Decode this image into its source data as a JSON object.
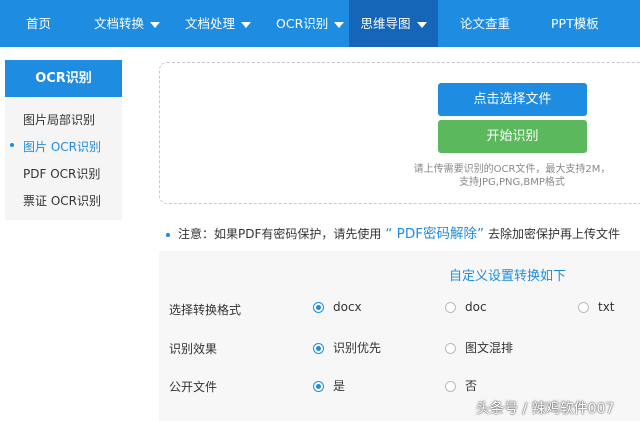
{
  "nav": {
    "items": [
      {
        "label": "首页",
        "has_caret": false
      },
      {
        "label": "文档转换",
        "has_caret": true
      },
      {
        "label": "文档处理",
        "has_caret": true
      },
      {
        "label": "OCR识别",
        "has_caret": true
      },
      {
        "label": "思维导图",
        "has_caret": true,
        "active": true
      },
      {
        "label": "论文查重",
        "has_caret": false
      },
      {
        "label": "PPT模板",
        "has_caret": false
      }
    ]
  },
  "sidebar": {
    "title": "OCR识别",
    "items": [
      {
        "label": "图片局部识别"
      },
      {
        "label": "图片 OCR识别",
        "active": true
      },
      {
        "label": "PDF OCR识别"
      },
      {
        "label": "票证 OCR识别"
      }
    ]
  },
  "upload": {
    "select_button": "点击选择文件",
    "start_button": "开始识别",
    "hint_line1": "请上传需要识别的OCR文件，最大支持2M，",
    "hint_line2": "支持JPG,PNG,BMP格式"
  },
  "notice": {
    "prefix": "注意：如果PDF有密码保护，请先使用",
    "link": "“ PDF密码解除”",
    "suffix": "去除加密保护再上传文件"
  },
  "settings": {
    "title": "自定义设置转换如下",
    "rows": [
      {
        "label": "选择转换格式",
        "options": [
          {
            "label": "docx",
            "checked": true
          },
          {
            "label": "doc",
            "checked": false
          },
          {
            "label": "txt",
            "checked": false
          }
        ]
      },
      {
        "label": "识别效果",
        "options": [
          {
            "label": "识别优先",
            "checked": true
          },
          {
            "label": "图文混排",
            "checked": false
          }
        ]
      },
      {
        "label": "公开文件",
        "options": [
          {
            "label": "是",
            "checked": true
          },
          {
            "label": "否",
            "checked": false
          }
        ]
      }
    ]
  },
  "watermark": "头条号 / 辣鸡软件007",
  "colors": {
    "accent": "#1e8ce0",
    "nav_active": "#1565b8",
    "start_button": "#5cb85c"
  }
}
